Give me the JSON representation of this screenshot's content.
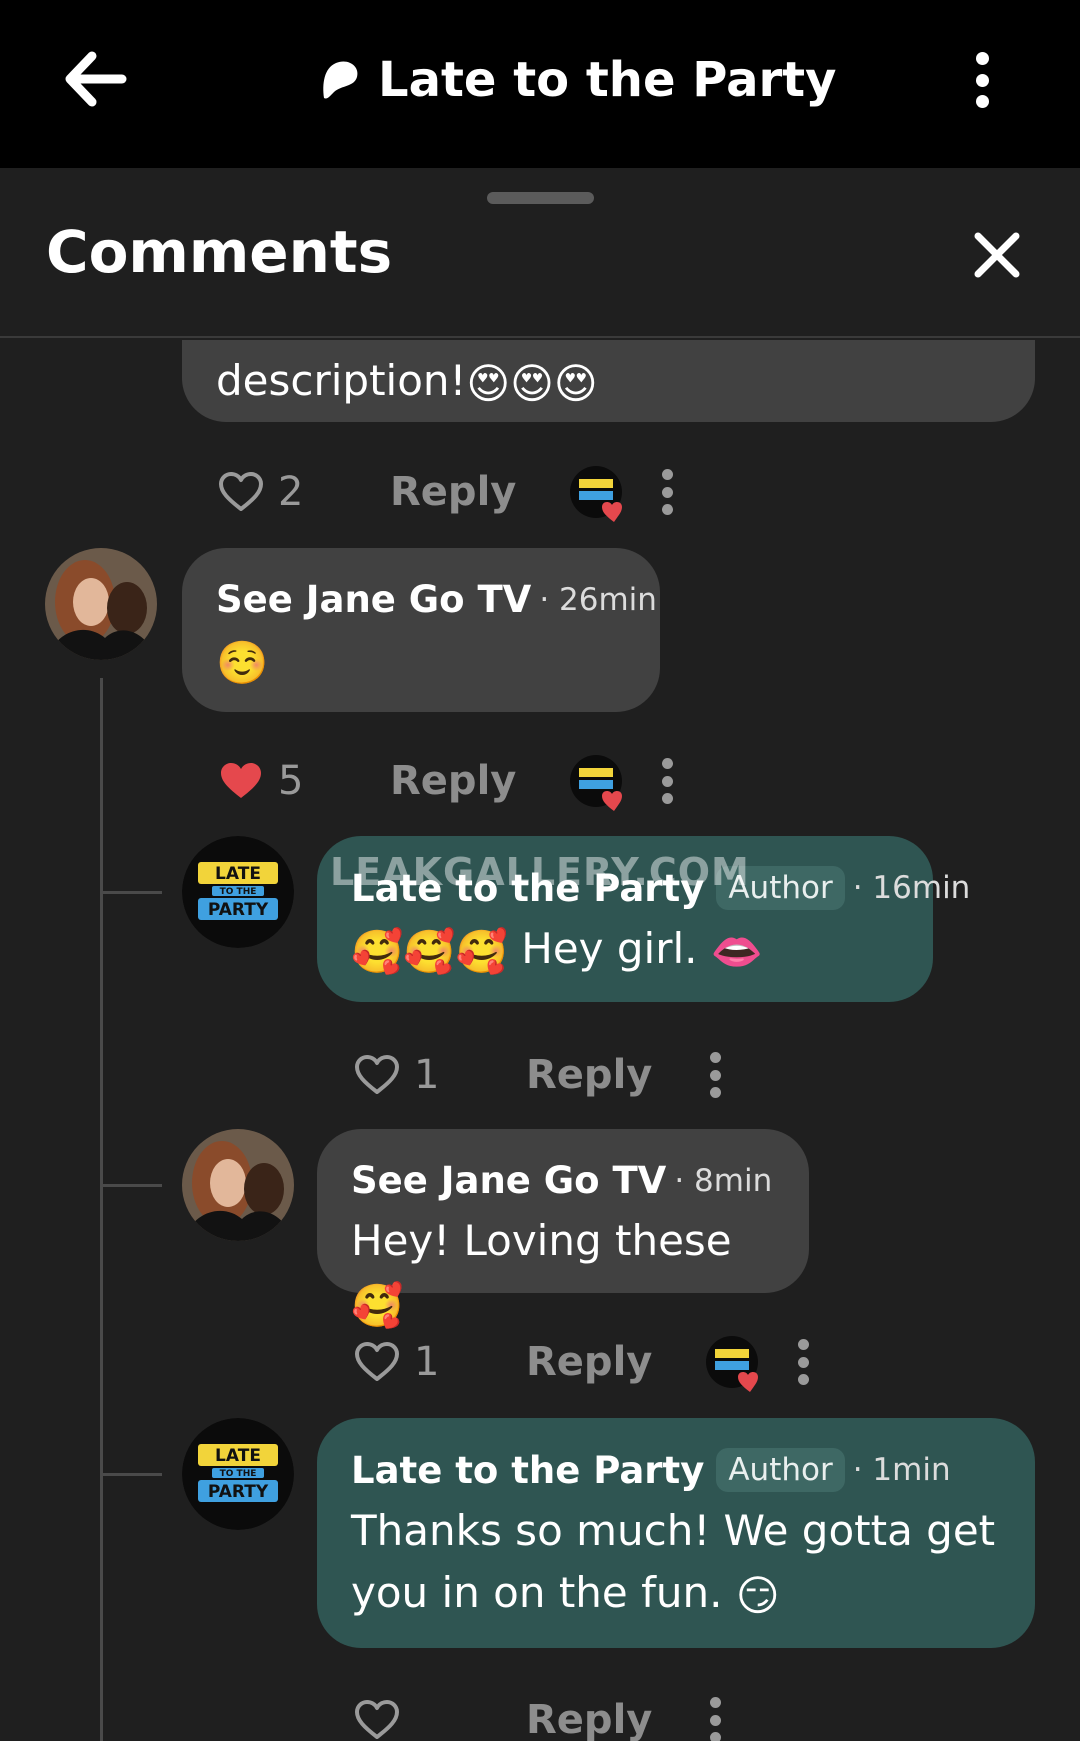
{
  "header": {
    "title": "Late to the Party",
    "back_icon": "arrow-left-icon",
    "menu_icon": "more-vertical-icon"
  },
  "sheet": {
    "title": "Comments",
    "close_icon": "close-icon"
  },
  "colors": {
    "top_bar": "#000000",
    "background": "#1f1f1f",
    "bubble": "#414141",
    "author_bubble": "#2f5552",
    "heart_liked": "#e5484d"
  },
  "comments": [
    {
      "text_tail": "description!",
      "emoji": "😍😍😍",
      "likes": "2",
      "liked": false,
      "reply_label": "Reply"
    },
    {
      "author": "See Jane Go TV",
      "time": "· 26min",
      "text": "",
      "emoji": "☺️",
      "likes": "5",
      "liked": true,
      "reply_label": "Reply"
    },
    {
      "author": "Late to the Party",
      "badge": "Author",
      "time": "· 16min",
      "emoji_lead": "🥰🥰🥰",
      "text": "Hey girl.",
      "emoji_tail": "👄",
      "likes": "1",
      "liked": false,
      "reply_label": "Reply"
    },
    {
      "author": "See Jane Go TV",
      "time": "· 8min",
      "text": "Hey! Loving these",
      "emoji_tail": "🥰",
      "likes": "1",
      "liked": false,
      "reply_label": "Reply"
    },
    {
      "author": "Late to the Party",
      "badge": "Author",
      "time": "· 1min",
      "text_line1": "Thanks so much! We gotta get",
      "text_line2": "you in on the fun.",
      "emoji_tail": "😏",
      "likes": "",
      "liked": false,
      "reply_label": "Reply"
    }
  ],
  "watermark": "LEAKGALLERY.COM",
  "avatar_logo": {
    "line1": "LATE",
    "line2": "TO THE",
    "line3": "PARTY"
  }
}
